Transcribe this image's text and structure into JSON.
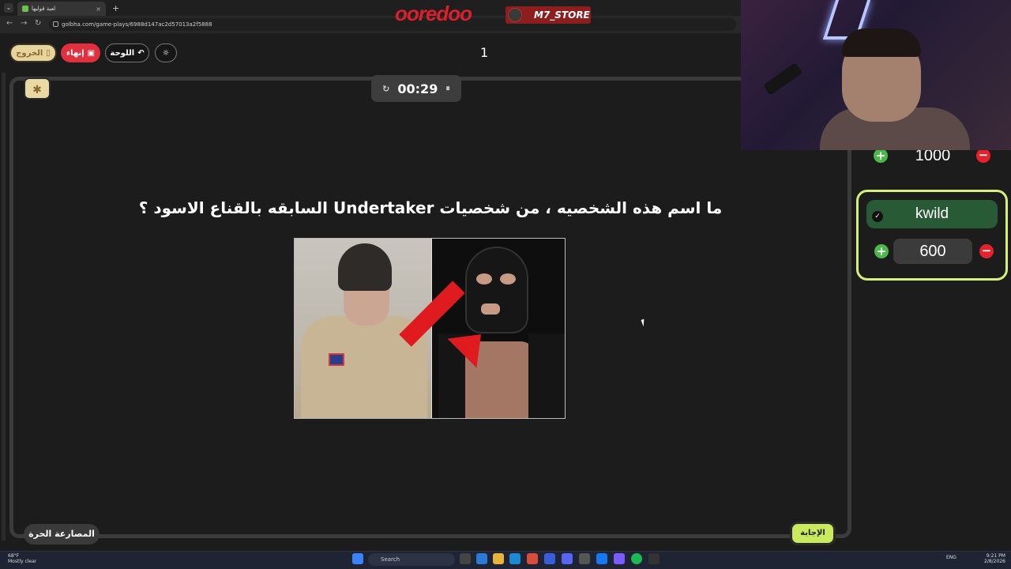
{
  "browser": {
    "tab_title": "لعبة قولبها",
    "url": "golbha.com/game-plays/6988d147ac2d57013a2f5888"
  },
  "overlay": {
    "brand": "ooredoo",
    "store": "M7_STORE"
  },
  "toolbar": {
    "exit_label": "الخروج",
    "end_label": "إنهاء",
    "board_label": "اللوحة",
    "question_number": "1"
  },
  "game": {
    "timer": "00:29",
    "question": "ما اسم هذه الشخصيه ، من شخصيات Undertaker السابقه بالقناع الاسود ؟",
    "category": "المصارعة الحرة",
    "answer_label": "الإجابة"
  },
  "teams": [
    {
      "name": "",
      "score": "1000"
    },
    {
      "name": "kwild",
      "score": "600"
    }
  ],
  "taskbar": {
    "weather_temp": "68°F",
    "weather_desc": "Mostly clear",
    "search_placeholder": "Search",
    "lang": "ENG",
    "time": "9:21 PM",
    "date": "2/8/2026"
  },
  "colors": {
    "end_button": "#e0303e",
    "exit_button": "#e7d49c",
    "active_team_border": "#d5f07a",
    "team_name_bg": "#285a36",
    "answer_button": "#c8ea5c"
  },
  "icons": [
    "back-icon",
    "forward-icon",
    "reload-icon",
    "lock-icon",
    "exit-door-icon",
    "check-clipboard-icon",
    "undo-arrow-icon",
    "sun-icon",
    "bug-icon",
    "restart-icon",
    "pause-icon",
    "plus-icon",
    "minus-icon",
    "check-icon"
  ]
}
